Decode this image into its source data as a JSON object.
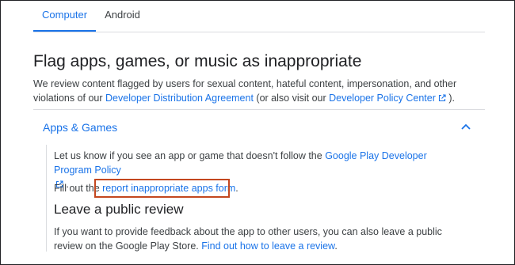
{
  "tabs": [
    {
      "label": "Computer",
      "active": true
    },
    {
      "label": "Android",
      "active": false
    }
  ],
  "title": "Flag apps, games, or music as inappropriate",
  "intro": {
    "text_before": "We review content flagged by users for sexual content, hateful content, impersonation, and other violations of our ",
    "link1": "Developer Distribution Agreement",
    "text_middle": " (or also visit our ",
    "link2": "Developer Policy Center",
    "text_after": " )."
  },
  "accordion": {
    "title": "Apps & Games",
    "expanded": true,
    "p1_text": "Let us know if you see an app or game that doesn't follow the ",
    "p1_link": "Google Play Developer Program Policy",
    "p1_end": " .",
    "p2_text": "Fill out the ",
    "p2_link": "report inappropriate apps form",
    "p2_end": ".",
    "review_heading": "Leave a public review",
    "p3_text": "If you want to provide feedback about the app to other users, you can also leave a public review on the Google Play Store. ",
    "p3_link": "Find out how to leave a review",
    "p3_end": "."
  },
  "colors": {
    "link": "#1a73e8",
    "highlight_border": "#c3471f",
    "divider": "#dadce0"
  },
  "icons": [
    "external-link-icon",
    "chevron-up-icon"
  ]
}
